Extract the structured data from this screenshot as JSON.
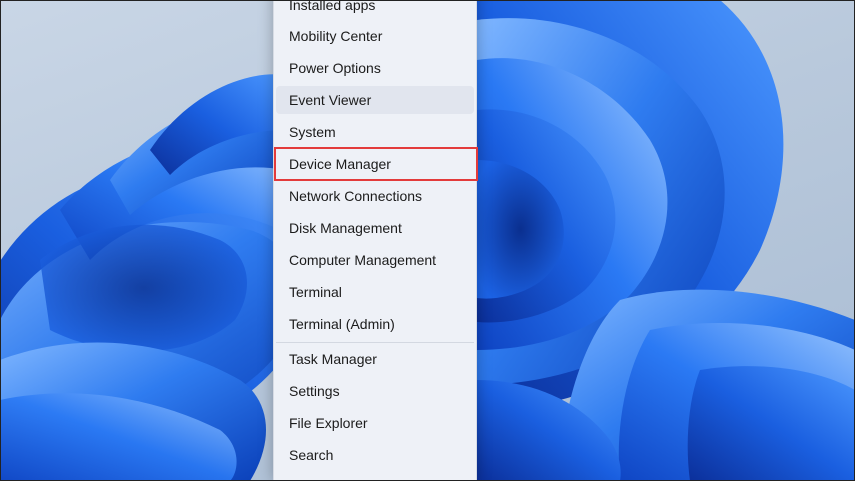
{
  "context_menu": {
    "items": [
      {
        "label": "Installed apps"
      },
      {
        "label": "Mobility Center"
      },
      {
        "label": "Power Options"
      },
      {
        "label": "Event Viewer"
      },
      {
        "label": "System"
      },
      {
        "label": "Device Manager"
      },
      {
        "label": "Network Connections"
      },
      {
        "label": "Disk Management"
      },
      {
        "label": "Computer Management"
      },
      {
        "label": "Terminal"
      },
      {
        "label": "Terminal (Admin)"
      },
      {
        "label": "Task Manager"
      },
      {
        "label": "Settings"
      },
      {
        "label": "File Explorer"
      },
      {
        "label": "Search"
      }
    ],
    "hovered_item": "Event Viewer",
    "highlighted_item": "Device Manager",
    "highlight_color": "#e33b3b",
    "background_color": "#eef1f7"
  },
  "wallpaper": {
    "name": "windows-11-bloom",
    "accent": "#1f6fe8"
  }
}
